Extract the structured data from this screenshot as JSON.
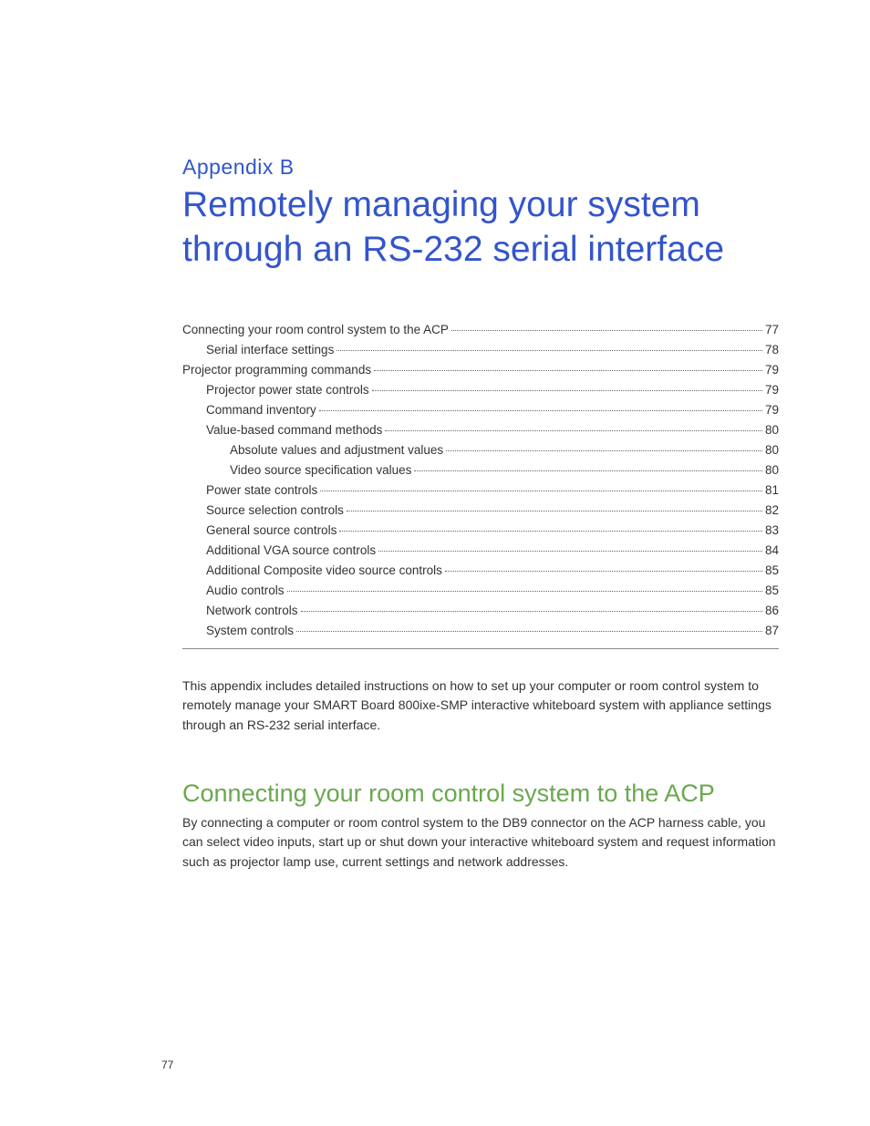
{
  "appendix_label": "Appendix B",
  "page_title": "Remotely managing your system through an RS-232 serial interface",
  "toc": [
    {
      "label": "Connecting your room control system to the ACP",
      "page": "77",
      "level": 0
    },
    {
      "label": "Serial interface settings",
      "page": "78",
      "level": 1
    },
    {
      "label": "Projector programming commands",
      "page": "79",
      "level": 0
    },
    {
      "label": "Projector power state controls",
      "page": "79",
      "level": 1
    },
    {
      "label": "Command inventory",
      "page": "79",
      "level": 1
    },
    {
      "label": "Value-based command methods",
      "page": "80",
      "level": 1
    },
    {
      "label": "Absolute values and adjustment values",
      "page": "80",
      "level": 2
    },
    {
      "label": "Video source specification values",
      "page": "80",
      "level": 2
    },
    {
      "label": "Power state controls",
      "page": "81",
      "level": 1
    },
    {
      "label": "Source selection controls",
      "page": "82",
      "level": 1
    },
    {
      "label": "General source controls",
      "page": "83",
      "level": 1
    },
    {
      "label": "Additional VGA source controls",
      "page": "84",
      "level": 1
    },
    {
      "label": "Additional Composite video source controls",
      "page": "85",
      "level": 1
    },
    {
      "label": "Audio controls",
      "page": "85",
      "level": 1
    },
    {
      "label": "Network controls",
      "page": "86",
      "level": 1
    },
    {
      "label": "System controls",
      "page": "87",
      "level": 1
    }
  ],
  "intro_paragraph": "This appendix includes detailed instructions on how to set up your computer or room control system to remotely manage your SMART Board 800ixe-SMP interactive whiteboard system with appliance settings through an RS-232 serial interface.",
  "section_heading": "Connecting your room control system to the ACP",
  "section_paragraph": "By connecting a computer or room control system to the DB9 connector on the ACP harness cable, you can select video inputs, start up or shut down your interactive whiteboard system and request information such as projector lamp use, current settings and network addresses.",
  "page_number": "77"
}
